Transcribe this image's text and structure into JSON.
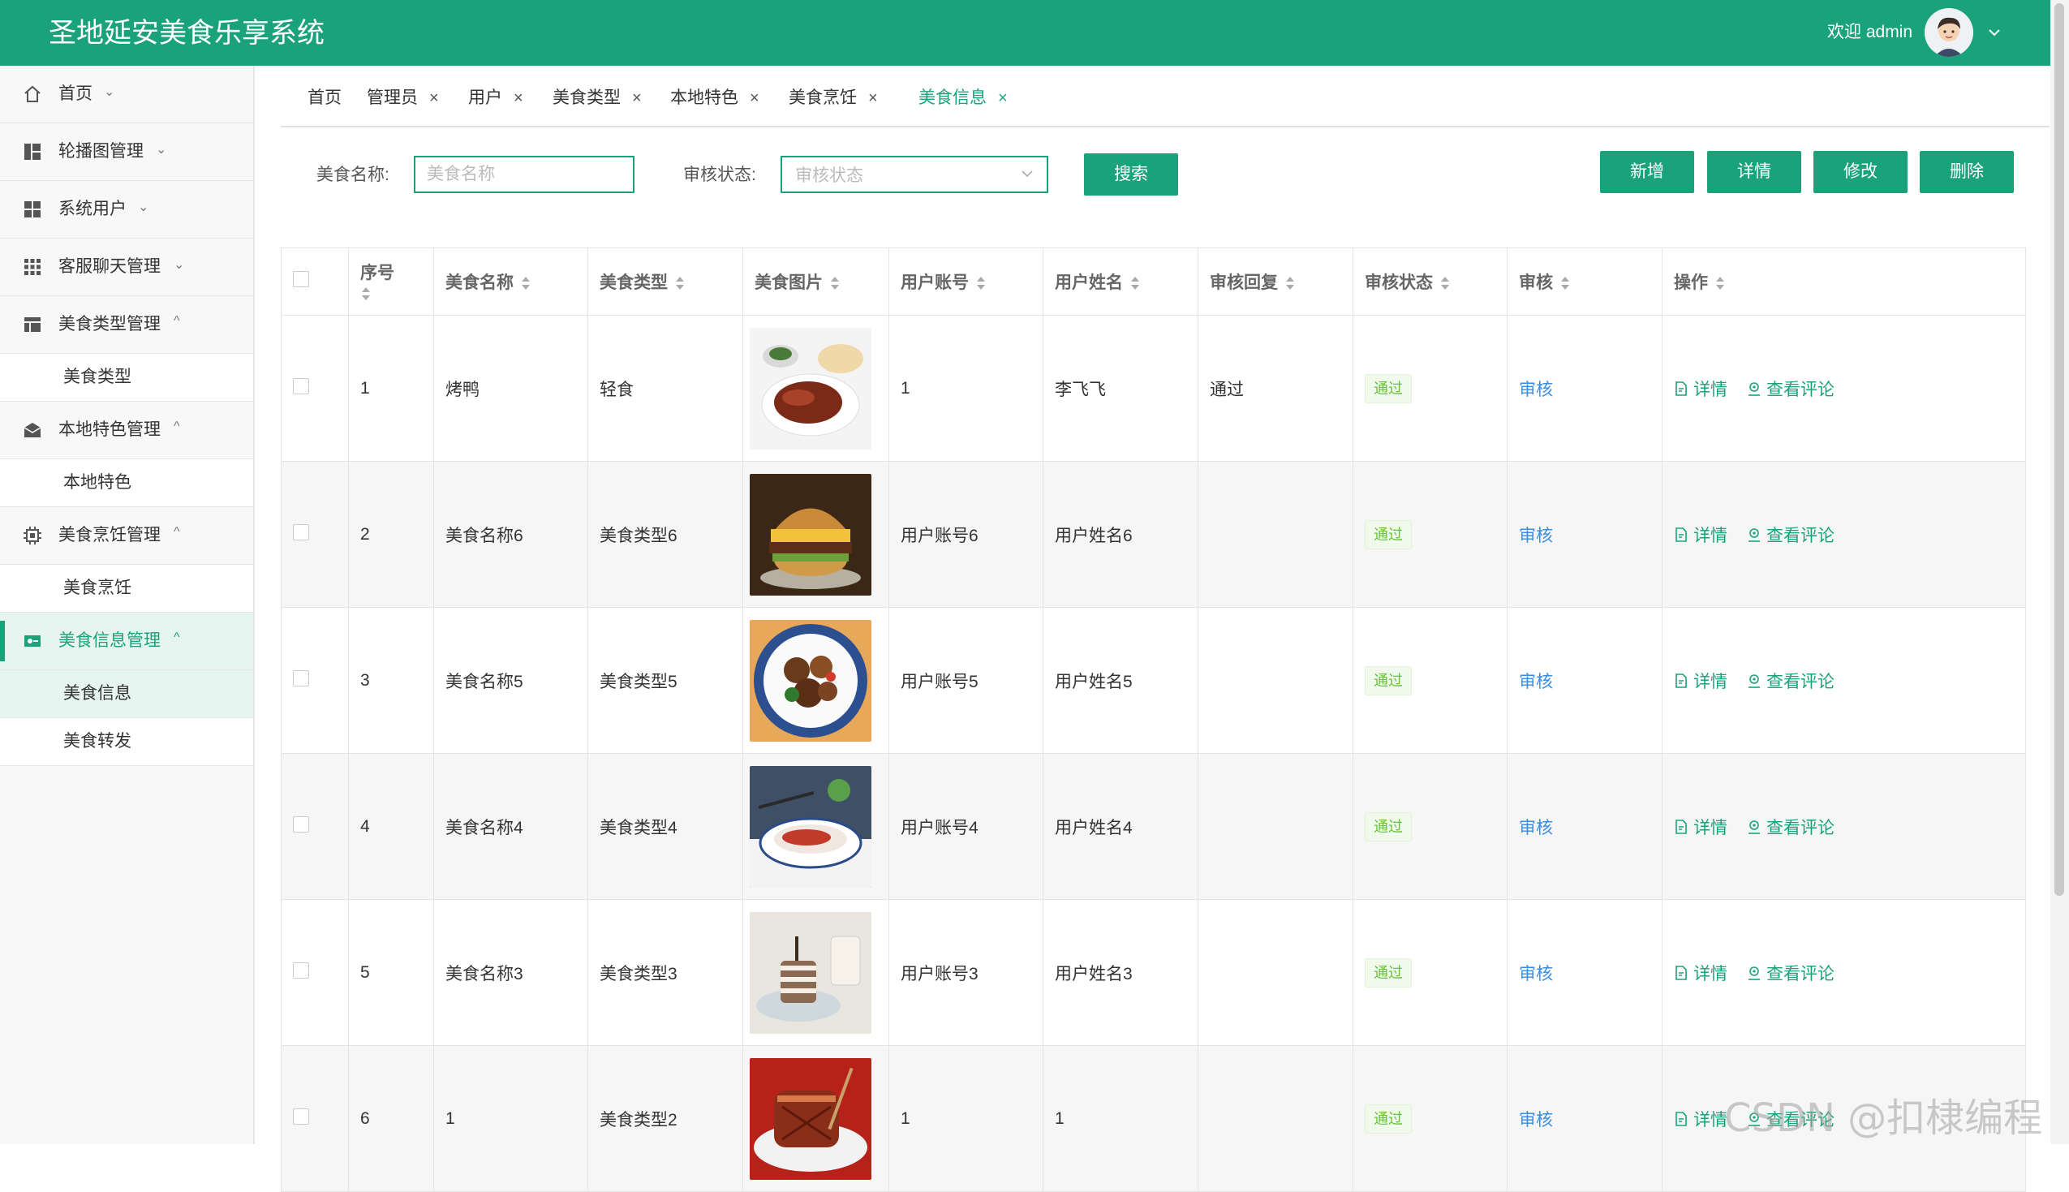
{
  "header": {
    "title": "圣地延安美食乐享系统",
    "welcome": "欢迎 admin"
  },
  "sidebar": {
    "items": [
      {
        "label": "首页",
        "icon": "home-icon",
        "chevron": "⌄"
      },
      {
        "label": "轮播图管理",
        "icon": "layout-icon",
        "chevron": "⌄"
      },
      {
        "label": "系统用户",
        "icon": "grid-icon",
        "chevron": "⌄"
      },
      {
        "label": "客服聊天管理",
        "icon": "apps-icon",
        "chevron": "⌄"
      },
      {
        "label": "美食类型管理",
        "icon": "table-icon",
        "chevron": "^"
      },
      {
        "label": "本地特色管理",
        "icon": "mail-icon",
        "chevron": "^"
      },
      {
        "label": "美食烹饪管理",
        "icon": "chip-icon",
        "chevron": "^"
      },
      {
        "label": "美食信息管理",
        "icon": "toggle-icon",
        "chevron": "^"
      }
    ],
    "subitems": {
      "food_type": "美食类型",
      "local": "本地特色",
      "cooking": "美食烹饪",
      "info": "美食信息",
      "forward": "美食转发"
    }
  },
  "tabs": [
    {
      "label": "首页"
    },
    {
      "label": "管理员",
      "close": "×"
    },
    {
      "label": "用户",
      "close": "×"
    },
    {
      "label": "美食类型",
      "close": "×"
    },
    {
      "label": "本地特色",
      "close": "×"
    },
    {
      "label": "美食烹饪",
      "close": "×"
    },
    {
      "label": "美食信息",
      "close": "×"
    }
  ],
  "search": {
    "name_label": "美食名称:",
    "name_placeholder": "美食名称",
    "status_label": "审核状态:",
    "status_placeholder": "审核状态",
    "search_button": "搜索"
  },
  "actions": {
    "add": "新增",
    "detail": "详情",
    "edit": "修改",
    "delete": "删除"
  },
  "table": {
    "headers": [
      "序号",
      "美食名称",
      "美食类型",
      "美食图片",
      "用户账号",
      "用户姓名",
      "审核回复",
      "审核状态",
      "审核",
      "操作"
    ],
    "rows": [
      {
        "index": "1",
        "name": "烤鸭",
        "type": "轻食",
        "account": "1",
        "username": "李飞飞",
        "reply": "通过",
        "status": "通过",
        "audit": "审核",
        "img": "duck"
      },
      {
        "index": "2",
        "name": "美食名称6",
        "type": "美食类型6",
        "account": "用户账号6",
        "username": "用户姓名6",
        "reply": "",
        "status": "通过",
        "audit": "审核",
        "img": "burger"
      },
      {
        "index": "3",
        "name": "美食名称5",
        "type": "美食类型5",
        "account": "用户账号5",
        "username": "用户姓名5",
        "reply": "",
        "status": "通过",
        "audit": "审核",
        "img": "stirfry"
      },
      {
        "index": "4",
        "name": "美食名称4",
        "type": "美食类型4",
        "account": "用户账号4",
        "username": "用户姓名4",
        "reply": "",
        "status": "通过",
        "audit": "审核",
        "img": "plate"
      },
      {
        "index": "5",
        "name": "美食名称3",
        "type": "美食类型3",
        "account": "用户账号3",
        "username": "用户姓名3",
        "reply": "",
        "status": "通过",
        "audit": "审核",
        "img": "cake"
      },
      {
        "index": "6",
        "name": "1",
        "type": "美食类型2",
        "account": "1",
        "username": "1",
        "reply": "",
        "status": "通过",
        "audit": "审核",
        "img": "meat"
      }
    ],
    "ops": {
      "detail": "详情",
      "comments": "查看评论"
    }
  },
  "watermark": "CSDN @扣棣编程",
  "colors": {
    "primary": "#1aa37a",
    "link": "#3a8ee6",
    "badge_text": "#67c23a"
  }
}
